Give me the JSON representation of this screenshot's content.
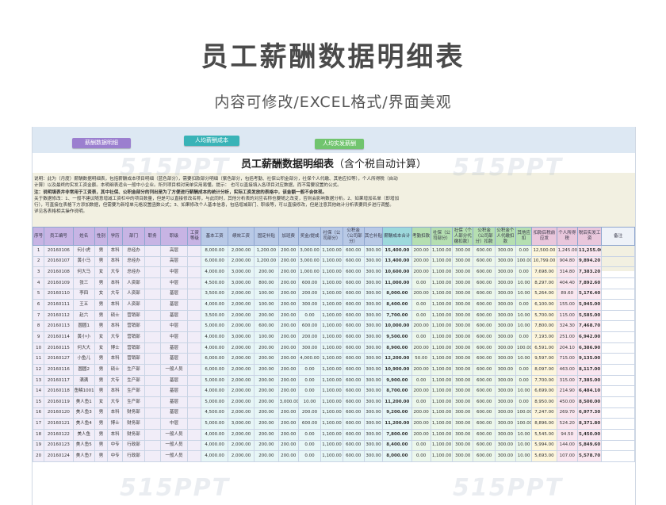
{
  "page": {
    "title": "员工薪酬数据明细表",
    "subtitle": "内容可修改/EXCEL格式/界面美观"
  },
  "toolbar": {
    "btn1": "薪酬数据明细",
    "btn2": "人均薪酬成本",
    "btn3": "人均实发薪酬"
  },
  "sheet": {
    "title": "员工薪酬数据明细表",
    "title_suffix": "（含个税自动计算）",
    "notes": [
      "说明：此为（月度）薪酬数据明细表，包括薪酬成本项目明细（蓝色部分），需要扣款部分明细（紫色部分，包括考勤、社保公积金部分，社保个人代缴、其他应扣等），个人所得税（自动",
      "计算）以及最终的实发工资金额。本明细表适合一般中小企业。所列项目相对简单实用易懂。提示：  也可以直接填入各项目对应数据，而不需要设置的公式。",
      "注：说明填表并非常用于工资表，其中社保、公积金部分的列出是为了方便进行薪酬成本的统计分析，实际工资发放的表格中，该金额一般不会体现。",
      "关于数据修改：1、一般不建议随意增减工资栏中的项目数量，但是可以直接修改名称，与此同时，其他分析表的对应名称也要随之改变，否则会影响数据分析。2、如果增加名单（即增加",
      "行），可直接在表格下方添加数据，但需要为新增单元格设置函数公式；3、如果修改个人基本信息，包括增减部门、职级等，可以直接修改，但是注意其他统计分析表要同步进行调整。",
      "详见各表格相关操作说明。"
    ],
    "watermark": "515PPT"
  },
  "table": {
    "headers": [
      "序号",
      "员工编号",
      "姓名",
      "性别",
      "学历",
      "部门",
      "职务",
      "职级",
      "工资等级",
      "基本工资",
      "绩效工资",
      "固定补贴",
      "加班费",
      "奖金/提成",
      "社保（公司部分）",
      "公积金（公司部分）",
      "其它补贴",
      "薪酬成本合计",
      "考勤扣款",
      "社保（公司部分）",
      "社保（个人部分代缴扣款）",
      "公积金（公司部分）扣款",
      "公积金个人代缴扣款",
      "其他应扣",
      "扣款后税前应发",
      "个人所得税",
      "税后实发工资",
      "备注"
    ],
    "rows": [
      [
        "1",
        "20160106",
        "何小虎",
        "男",
        "本科",
        "总经办",
        "",
        "高层",
        "",
        "8,000.00",
        "2,000.00",
        "1,200.00",
        "200.00",
        "3,000.00",
        "1,100.00",
        "600.00",
        "300.00",
        "15,400.00",
        "200.00",
        "1,100.00",
        "300.00",
        "600.00",
        "300.00",
        "0.00",
        "12,500.00",
        "1,245.00",
        "11,255.00",
        ""
      ],
      [
        "2",
        "20160107",
        "黄小马",
        "男",
        "本科",
        "总经办",
        "",
        "高层",
        "",
        "6,000.00",
        "2,000.00",
        "1,200.00",
        "200.00",
        "3,000.00",
        "1,100.00",
        "600.00",
        "300.00",
        "13,400.00",
        "200.00",
        "1,100.00",
        "300.00",
        "600.00",
        "300.00",
        "100.00",
        "10,799.00",
        "904.80",
        "9,894.20",
        ""
      ],
      [
        "3",
        "20160108",
        "何大马",
        "女",
        "大专",
        "总经办",
        "",
        "中层",
        "",
        "4,000.00",
        "3,000.00",
        "200.00",
        "200.00",
        "1,000.00",
        "1,100.00",
        "600.00",
        "300.00",
        "10,600.00",
        "200.00",
        "1,100.00",
        "300.00",
        "600.00",
        "300.00",
        "0.00",
        "7,698.00",
        "314.80",
        "7,383.20",
        ""
      ],
      [
        "4",
        "20160109",
        "张三",
        "男",
        "本科",
        "人资部",
        "",
        "中层",
        "",
        "4,500.00",
        "3,000.00",
        "800.00",
        "200.00",
        "600.00",
        "1,100.00",
        "600.00",
        "300.00",
        "11,000.00",
        "0.00",
        "1,100.00",
        "300.00",
        "600.00",
        "300.00",
        "10.00",
        "8,297.00",
        "404.40",
        "7,892.60",
        ""
      ],
      [
        "5",
        "20160110",
        "李四",
        "女",
        "大专",
        "人资部",
        "",
        "基层",
        "",
        "3,500.00",
        "2,000.00",
        "100.00",
        "200.00",
        "200.00",
        "1,100.00",
        "600.00",
        "300.00",
        "8,000.00",
        "200.00",
        "1,100.00",
        "300.00",
        "600.00",
        "300.00",
        "10.00",
        "5,264.00",
        "89.60",
        "5,176.40",
        ""
      ],
      [
        "6",
        "20160111",
        "王五",
        "男",
        "本科",
        "人资部",
        "",
        "基层",
        "",
        "4,000.00",
        "2,000.00",
        "100.00",
        "200.00",
        "300.00",
        "1,100.00",
        "600.00",
        "300.00",
        "8,400.00",
        "0.00",
        "1,100.00",
        "300.00",
        "600.00",
        "300.00",
        "0.00",
        "6,100.00",
        "155.00",
        "5,945.00",
        ""
      ],
      [
        "7",
        "20160112",
        "赵六",
        "男",
        "硕士",
        "营销部",
        "",
        "基层",
        "",
        "3,500.00",
        "2,000.00",
        "200.00",
        "200.00",
        "0.00",
        "1,100.00",
        "600.00",
        "300.00",
        "7,700.00",
        "0.00",
        "1,100.00",
        "300.00",
        "600.00",
        "300.00",
        "10.00",
        "5,700.00",
        "115.00",
        "5,585.00",
        ""
      ],
      [
        "8",
        "20160113",
        "圆圆1",
        "男",
        "本科",
        "营销部",
        "",
        "中层",
        "",
        "5,000.00",
        "2,000.00",
        "600.00",
        "200.00",
        "600.00",
        "1,100.00",
        "600.00",
        "300.00",
        "10,000.00",
        "200.00",
        "1,100.00",
        "300.00",
        "600.00",
        "300.00",
        "10.00",
        "7,800.00",
        "324.30",
        "7,468.70",
        ""
      ],
      [
        "9",
        "20160114",
        "黄小小",
        "女",
        "大专",
        "营销部",
        "",
        "中层",
        "",
        "4,000.00",
        "3,000.00",
        "100.00",
        "200.00",
        "200.00",
        "1,100.00",
        "600.00",
        "300.00",
        "9,500.00",
        "0.00",
        "1,100.00",
        "300.00",
        "600.00",
        "300.00",
        "0.00",
        "7,193.00",
        "251.00",
        "6,942.00",
        ""
      ],
      [
        "10",
        "20160115",
        "何大大",
        "女",
        "博士",
        "营销部",
        "",
        "基层",
        "",
        "4,000.00",
        "2,000.00",
        "200.00",
        "200.00",
        "300.00",
        "1,100.00",
        "600.00",
        "300.00",
        "8,900.00",
        "200.00",
        "1,100.00",
        "300.00",
        "600.00",
        "300.00",
        "100.00",
        "6,591.00",
        "204.10",
        "6,386.90",
        ""
      ],
      [
        "11",
        "20160127",
        "小鱼儿",
        "男",
        "本科",
        "营销部",
        "",
        "基层",
        "",
        "6,000.00",
        "2,000.00",
        "200.00",
        "200.00",
        "4,000.00",
        "1,100.00",
        "600.00",
        "300.00",
        "12,200.00",
        "50.00",
        "1,100.00",
        "300.00",
        "600.00",
        "300.00",
        "10.00",
        "9,597.00",
        "715.00",
        "9,135.00",
        ""
      ],
      [
        "12",
        "20160116",
        "圆圆2",
        "男",
        "硕士",
        "生产部",
        "",
        "一般人员",
        "",
        "6,000.00",
        "2,000.00",
        "200.00",
        "200.00",
        "0.00",
        "1,100.00",
        "600.00",
        "300.00",
        "10,900.00",
        "200.00",
        "1,100.00",
        "300.00",
        "600.00",
        "300.00",
        "0.00",
        "8,097.00",
        "463.00",
        "8,117.00",
        ""
      ],
      [
        "13",
        "20160117",
        "满满",
        "男",
        "大专",
        "生产部",
        "",
        "基层",
        "",
        "5,000.00",
        "2,000.00",
        "200.00",
        "200.00",
        "0.00",
        "1,100.00",
        "600.00",
        "300.00",
        "9,900.00",
        "0.00",
        "1,100.00",
        "300.00",
        "600.00",
        "300.00",
        "0.00",
        "7,700.00",
        "315.00",
        "7,385.00",
        ""
      ],
      [
        "14",
        "20160118",
        "鱼鳞1001",
        "男",
        "本科",
        "生产部",
        "",
        "基层",
        "",
        "4,000.00",
        "2,000.00",
        "200.00",
        "200.00",
        "0.00",
        "1,100.00",
        "600.00",
        "300.00",
        "8,700.00",
        "200.00",
        "1,100.00",
        "300.00",
        "600.00",
        "300.00",
        "10.00",
        "6,699.00",
        "214.90",
        "6,484.10",
        ""
      ],
      [
        "15",
        "20160119",
        "美人鱼1",
        "女",
        "大专",
        "生产部",
        "",
        "基层",
        "",
        "5,000.00",
        "2,000.00",
        "200.00",
        "3,000.00",
        "10.00",
        "1,100.00",
        "600.00",
        "300.00",
        "11,200.00",
        "0.00",
        "1,100.00",
        "300.00",
        "600.00",
        "300.00",
        "0.00",
        "8,950.00",
        "450.00",
        "8,500.00",
        ""
      ],
      [
        "16",
        "20160120",
        "美人鱼3",
        "男",
        "本科",
        "财务部",
        "",
        "基层",
        "",
        "4,500.00",
        "2,000.00",
        "200.00",
        "200.00",
        "200.00",
        "1,100.00",
        "600.00",
        "300.00",
        "9,200.00",
        "200.00",
        "1,100.00",
        "300.00",
        "600.00",
        "300.00",
        "100.00",
        "7,247.00",
        "269.70",
        "6,977.30",
        ""
      ],
      [
        "17",
        "20160121",
        "美人鱼4",
        "男",
        "博士",
        "财务部",
        "",
        "中层",
        "",
        "5,000.00",
        "3,000.00",
        "200.00",
        "200.00",
        "600.00",
        "1,100.00",
        "600.00",
        "300.00",
        "11,200.00",
        "200.00",
        "1,100.00",
        "300.00",
        "600.00",
        "300.00",
        "100.00",
        "8,896.00",
        "524.20",
        "8,371.80",
        ""
      ],
      [
        "18",
        "20160122",
        "美人鱼",
        "男",
        "本科",
        "财务部",
        "",
        "一般人员",
        "",
        "4,000.00",
        "2,000.00",
        "200.00",
        "200.00",
        "0.00",
        "1,100.00",
        "600.00",
        "300.00",
        "7,800.00",
        "200.00",
        "1,100.00",
        "300.00",
        "600.00",
        "300.00",
        "10.00",
        "5,545.00",
        "94.50",
        "5,450.00",
        ""
      ],
      [
        "19",
        "20160123",
        "美人鱼5",
        "男",
        "中专",
        "行政部",
        "",
        "一般人员",
        "",
        "4,000.00",
        "2,000.00",
        "200.00",
        "200.00",
        "0.00",
        "1,100.00",
        "600.00",
        "300.00",
        "8,400.00",
        "0.00",
        "1,100.00",
        "300.00",
        "600.00",
        "300.00",
        "10.00",
        "5,994.00",
        "144.00",
        "5,849.60",
        ""
      ],
      [
        "20",
        "20160124",
        "美人鱼7",
        "男",
        "中专",
        "行政部",
        "",
        "一般人员",
        "",
        "4,000.00",
        "2,000.00",
        "200.00",
        "200.00",
        "0.00",
        "1,100.00",
        "600.00",
        "300.00",
        "8,000.00",
        "0.00",
        "1,100.00",
        "300.00",
        "600.00",
        "300.00",
        "10.00",
        "5,693.00",
        "107.00",
        "5,578.70",
        ""
      ]
    ]
  }
}
